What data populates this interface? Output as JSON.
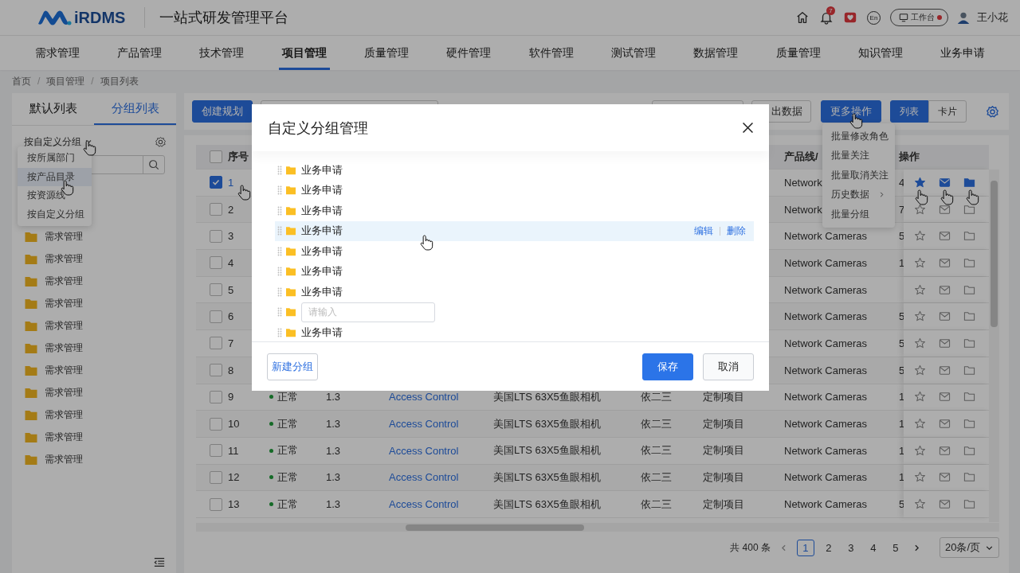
{
  "header": {
    "logo_text": "iRDMS",
    "platform_title": "一站式研发管理平台",
    "notification_count": "7",
    "language": "En",
    "workbench": "工作台",
    "user": "王小花"
  },
  "nav": [
    {
      "label": "需求管理",
      "selected": false
    },
    {
      "label": "产品管理",
      "selected": false
    },
    {
      "label": "技术管理",
      "selected": false
    },
    {
      "label": "项目管理",
      "selected": true
    },
    {
      "label": "质量管理",
      "selected": false
    },
    {
      "label": "硬件管理",
      "selected": false
    },
    {
      "label": "软件管理",
      "selected": false
    },
    {
      "label": "测试管理",
      "selected": false
    },
    {
      "label": "数据管理",
      "selected": false
    },
    {
      "label": "质量管理",
      "selected": false
    },
    {
      "label": "知识管理",
      "selected": false
    },
    {
      "label": "业务申请",
      "selected": false
    }
  ],
  "breadcrumb": {
    "items": [
      "首页",
      "项目管理",
      "项目列表"
    ],
    "separator": "/"
  },
  "sidebar": {
    "tabs": [
      {
        "label": "默认列表",
        "selected": false
      },
      {
        "label": "分组列表",
        "selected": true
      }
    ],
    "group_by": "按自定义分组",
    "group_menu": [
      {
        "label": "按所属部门",
        "selected": false
      },
      {
        "label": "按产品目录",
        "selected": true
      },
      {
        "label": "按资源线",
        "selected": false
      },
      {
        "label": "按自定义分组",
        "selected": false
      }
    ],
    "folders": [
      "需求管理",
      "需求管理",
      "需求管理",
      "需求管理",
      "需求管理",
      "需求管理",
      "需求管理",
      "需求管理",
      "需求管理",
      "需求管理",
      "需求管理"
    ]
  },
  "toolbar": {
    "create": "创建规划",
    "export": "出数据",
    "more": "更多操作",
    "views": [
      {
        "label": "列表",
        "selected": true
      },
      {
        "label": "卡片",
        "selected": false
      }
    ]
  },
  "more_menu": [
    {
      "label": "批量修改角色",
      "kind": "item"
    },
    {
      "label": "批量关注",
      "kind": "item"
    },
    {
      "label": "批量取消关注",
      "kind": "item"
    },
    {
      "label": "历史数据",
      "kind": "submenu"
    },
    {
      "label": "批量分组",
      "kind": "item"
    }
  ],
  "table": {
    "select_all_checked": false,
    "columns": {
      "no": "序号",
      "product_line": "产品线/",
      "actions": "操作"
    },
    "rows": [
      {
        "checked": true,
        "no": "1",
        "product_line": "Network",
        "column_10": "4",
        "active": true
      },
      {
        "checked": false,
        "no": "2",
        "product_line": "Network",
        "column_10": "7",
        "active": false
      },
      {
        "checked": false,
        "no": "3",
        "product_line": "Network Cameras",
        "column_10": "5",
        "active": false
      },
      {
        "checked": false,
        "no": "4",
        "product_line": "Network Cameras",
        "column_10": "1",
        "active": false
      },
      {
        "checked": false,
        "no": "5",
        "product_line": "Network Cameras",
        "active": false
      },
      {
        "checked": false,
        "no": "6",
        "product_line": "Network Cameras",
        "column_10": "5",
        "active": false
      },
      {
        "checked": false,
        "no": "7",
        "product_line": "Network Cameras",
        "column_10": "5",
        "active": false
      },
      {
        "checked": false,
        "no": "8",
        "product_line": "Network Cameras",
        "column_10": "5",
        "active": false
      },
      {
        "checked": false,
        "no": "9",
        "status": "正常",
        "version": "1.3",
        "product": "Access Control",
        "model": "美国LTS 63X5鱼眼相机",
        "owner": "依二三",
        "type": "定制项目",
        "product_line": "Network Cameras",
        "column_10": "1",
        "active": false
      },
      {
        "checked": false,
        "no": "10",
        "status": "正常",
        "version": "1.3",
        "product": "Access Control",
        "model": "美国LTS 63X5鱼眼相机",
        "owner": "依二三",
        "type": "定制项目",
        "product_line": "Network Cameras",
        "column_10": "1",
        "active": false
      },
      {
        "checked": false,
        "no": "11",
        "status": "正常",
        "version": "1.3",
        "product": "Access Control",
        "model": "美国LTS 63X5鱼眼相机",
        "owner": "依二三",
        "type": "定制项目",
        "product_line": "Network Cameras",
        "column_10": "1",
        "active": false
      },
      {
        "checked": false,
        "no": "12",
        "status": "正常",
        "version": "1.3",
        "product": "Access Control",
        "model": "美国LTS 63X5鱼眼相机",
        "owner": "依二三",
        "type": "定制项目",
        "product_line": "Network Cameras",
        "column_10": "1",
        "active": false
      },
      {
        "checked": false,
        "no": "13",
        "status": "正常",
        "version": "1.3",
        "product": "Access Control",
        "model": "美国LTS 63X5鱼眼相机",
        "owner": "依二三",
        "type": "定制项目",
        "product_line": "Network Cameras",
        "column_10": "5",
        "active": false
      }
    ]
  },
  "pagination": {
    "total": "共 400 条",
    "pages": [
      {
        "label": "1",
        "selected": true
      },
      {
        "label": "2",
        "selected": false
      },
      {
        "label": "3",
        "selected": false
      },
      {
        "label": "4",
        "selected": false
      },
      {
        "label": "5",
        "selected": false
      }
    ],
    "page_size": "20条/页"
  },
  "dialog": {
    "title": "自定义分组管理",
    "groups": [
      {
        "kind": "group",
        "label": "业务申请",
        "highlighted": false
      },
      {
        "kind": "group",
        "label": "业务申请",
        "highlighted": false
      },
      {
        "kind": "group",
        "label": "业务申请",
        "highlighted": false
      },
      {
        "kind": "group",
        "label": "业务申请",
        "highlighted": true,
        "actions": [
          "编辑",
          "删除"
        ]
      },
      {
        "kind": "group",
        "label": "业务申请",
        "highlighted": false
      },
      {
        "kind": "group",
        "label": "业务申请",
        "highlighted": false
      },
      {
        "kind": "group",
        "label": "业务申请",
        "highlighted": false
      },
      {
        "kind": "input",
        "placeholder": "请输入"
      },
      {
        "kind": "group",
        "label": "业务申请",
        "highlighted": false
      }
    ],
    "new_button": "新建分组",
    "save": "保存",
    "cancel": "取消"
  }
}
